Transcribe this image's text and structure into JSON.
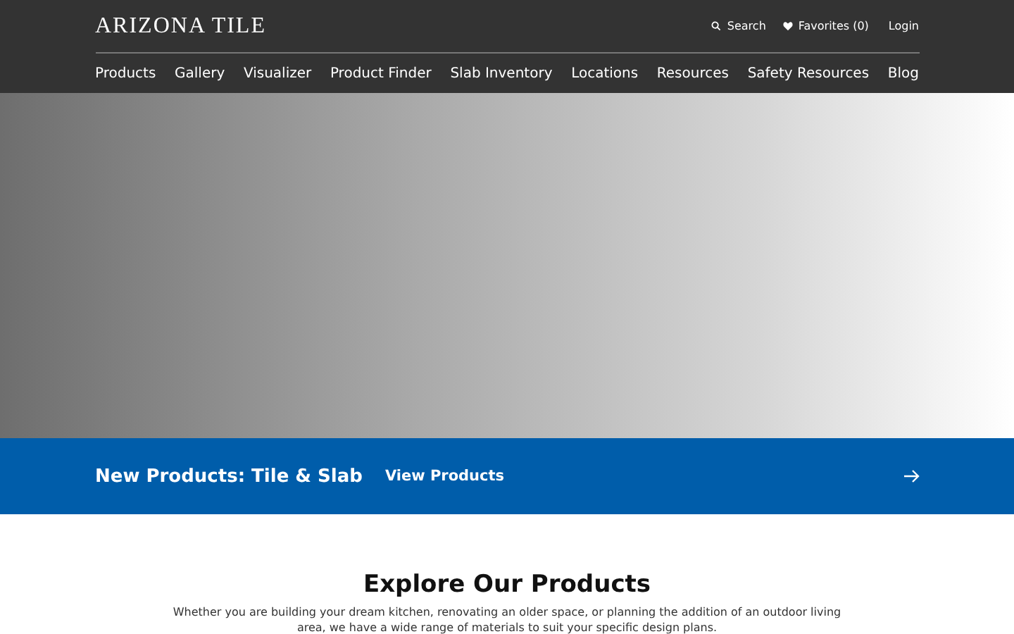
{
  "header": {
    "logo": "ARIZONA TILE",
    "search": "Search",
    "favorites": "Favorites (0)",
    "login": "Login"
  },
  "nav": [
    "Products",
    "Gallery",
    "Visualizer",
    "Product Finder",
    "Slab Inventory",
    "Locations",
    "Resources",
    "Safety Resources",
    "Blog"
  ],
  "promo": {
    "title": "New Products: Tile & Slab",
    "link": "View Products"
  },
  "explore": {
    "heading": "Explore Our Products",
    "text": "Whether you are building your dream kitchen, renovating an older space, or planning the addition of an outdoor living area, we have a wide range of materials to suit your specific design plans."
  }
}
